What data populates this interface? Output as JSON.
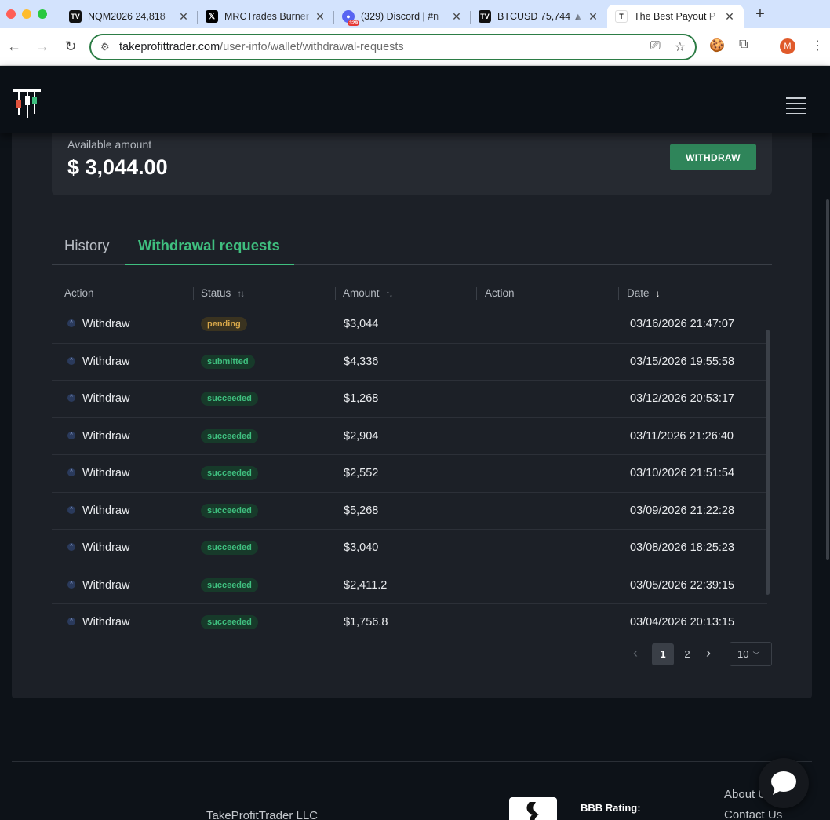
{
  "browser": {
    "tabs": [
      {
        "title": "NQM2026 24,818",
        "icon": "tradingview-icon",
        "active": false
      },
      {
        "title": "MRCTrades Burner",
        "icon": "x-icon",
        "active": false
      },
      {
        "title": "(329) Discord | #n",
        "icon": "discord-icon",
        "badge": "329",
        "active": false
      },
      {
        "title": "BTCUSD 75,744 ▲",
        "icon": "tradingview-icon",
        "active": false
      },
      {
        "title": "The Best Payout P",
        "icon": "takeprofit-icon",
        "active": true
      }
    ],
    "url_domain": "takeprofittrader.com",
    "url_path": "/user-info/wallet/withdrawal-requests",
    "profile_initial": "M"
  },
  "wallet": {
    "available_label": "Available amount",
    "available_value": "$ 3,044.00",
    "withdraw_label": "WITHDRAW"
  },
  "tabs": {
    "history": "History",
    "withdrawal_requests": "Withdrawal requests",
    "active": "withdrawal_requests"
  },
  "table": {
    "headers": {
      "action1": "Action",
      "status": "Status",
      "amount": "Amount",
      "action2": "Action",
      "date": "Date"
    },
    "rows": [
      {
        "action": "Withdraw",
        "status": "pending",
        "amount": "$3,044",
        "date": "03/16/2026 21:47:07"
      },
      {
        "action": "Withdraw",
        "status": "submitted",
        "amount": "$4,336",
        "date": "03/15/2026 19:55:58"
      },
      {
        "action": "Withdraw",
        "status": "succeeded",
        "amount": "$1,268",
        "date": "03/12/2026 20:53:17"
      },
      {
        "action": "Withdraw",
        "status": "succeeded",
        "amount": "$2,904",
        "date": "03/11/2026 21:26:40"
      },
      {
        "action": "Withdraw",
        "status": "succeeded",
        "amount": "$2,552",
        "date": "03/10/2026 21:51:54"
      },
      {
        "action": "Withdraw",
        "status": "succeeded",
        "amount": "$5,268",
        "date": "03/09/2026 21:22:28"
      },
      {
        "action": "Withdraw",
        "status": "succeeded",
        "amount": "$3,040",
        "date": "03/08/2026 18:25:23"
      },
      {
        "action": "Withdraw",
        "status": "succeeded",
        "amount": "$2,411.2",
        "date": "03/05/2026 22:39:15"
      },
      {
        "action": "Withdraw",
        "status": "succeeded",
        "amount": "$1,756.8",
        "date": "03/04/2026 20:13:15"
      }
    ]
  },
  "pagination": {
    "pages": [
      "1",
      "2"
    ],
    "current": "1",
    "page_size": "10"
  },
  "footer": {
    "company": "TakeProfitTrader LLC",
    "bbb_text": "BBB Rating:",
    "links": [
      "About Us",
      "Contact Us"
    ]
  },
  "colors": {
    "accent_green": "#3fbf7f",
    "button_green": "#2f855a",
    "pending_amber": "#d8a84a",
    "background": "#0d1218",
    "card": "#1c2027"
  }
}
